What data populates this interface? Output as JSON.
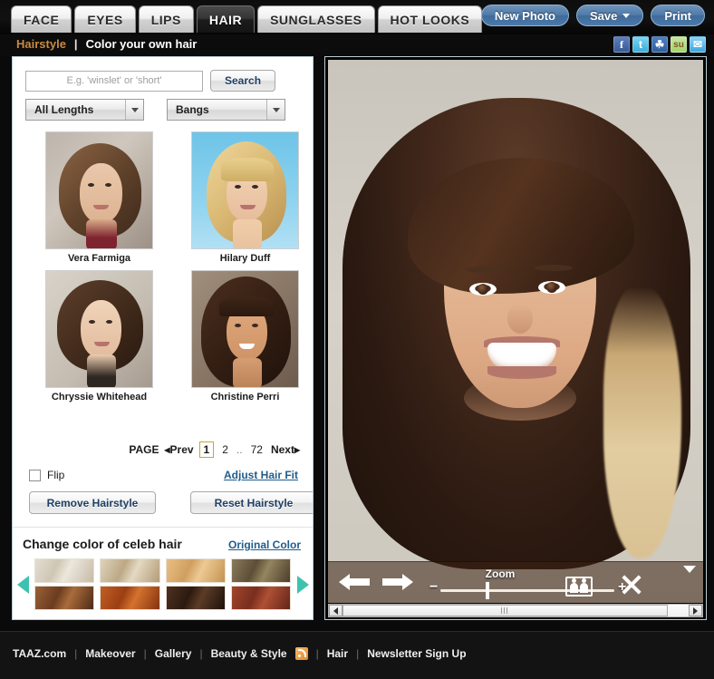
{
  "header": {
    "tabs": [
      {
        "label": "FACE",
        "active": false
      },
      {
        "label": "EYES",
        "active": false
      },
      {
        "label": "LIPS",
        "active": false
      },
      {
        "label": "HAIR",
        "active": true
      },
      {
        "label": "SUNGLASSES",
        "active": false
      },
      {
        "label": "HOT LOOKS",
        "active": false
      }
    ],
    "actions": {
      "new_photo": "New Photo",
      "save": "Save",
      "print": "Print"
    },
    "breadcrumb": {
      "section": "Hairstyle",
      "separator": "|",
      "page": "Color your own hair"
    },
    "social": [
      {
        "name": "facebook-icon",
        "glyph": "f"
      },
      {
        "name": "twitter-icon",
        "glyph": "t"
      },
      {
        "name": "myspace-icon",
        "glyph": "☘"
      },
      {
        "name": "stumbleupon-icon",
        "glyph": "su"
      },
      {
        "name": "email-icon",
        "glyph": "✉"
      }
    ]
  },
  "sidebar": {
    "search": {
      "placeholder": "E.g. 'winslet' or 'short'",
      "value": "",
      "button": "Search"
    },
    "filters": [
      {
        "name": "length-select",
        "value": "All Lengths"
      },
      {
        "name": "bangs-select",
        "value": "Bangs"
      }
    ],
    "celebrities": [
      {
        "name": "Vera Farmiga",
        "bg": "bg1",
        "hair": "#6b4a32",
        "skin": "#e8c2a4"
      },
      {
        "name": "Hilary Duff",
        "bg": "bg2",
        "hair": "#d9b877",
        "skin": "#f0cfb0"
      },
      {
        "name": "Chryssie Whitehead",
        "bg": "bg3",
        "hair": "#4b3225",
        "skin": "#ead0b6"
      },
      {
        "name": "Christine Perri",
        "bg": "bg4",
        "hair": "#3b2418",
        "skin": "#d9a478"
      }
    ],
    "pagination": {
      "label": "PAGE",
      "prev": "◂Prev",
      "current": "1",
      "pages": [
        "2"
      ],
      "ellipsis": "..",
      "last": "72",
      "next": "Next▸"
    },
    "flip": {
      "label": "Flip",
      "checked": false
    },
    "adjust_link": "Adjust Hair Fit",
    "buttons": {
      "remove": "Remove Hairstyle",
      "reset": "Reset Hairstyle"
    },
    "color_section": {
      "title": "Change color of celeb hair",
      "original_link": "Original Color",
      "prev_arrow": "scroll-left",
      "next_arrow": "scroll-right",
      "swatches": [
        {
          "name": "light-ash-blonde",
          "color": "#d8cfc0"
        },
        {
          "name": "beige-blonde",
          "color": "#c9b799"
        },
        {
          "name": "golden-blonde",
          "color": "#d9a86a"
        },
        {
          "name": "dark-ash-brown",
          "color": "#6e5c45"
        },
        {
          "name": "medium-brown",
          "color": "#7b4a2c"
        },
        {
          "name": "copper-red",
          "color": "#b0481f"
        },
        {
          "name": "dark-brown",
          "color": "#3c2415"
        },
        {
          "name": "auburn-red",
          "color": "#8c3a28"
        }
      ]
    }
  },
  "viewer": {
    "toolbar": {
      "back": "back-arrow",
      "forward": "forward-arrow",
      "zoom_label": "Zoom",
      "zoom_minus": "−",
      "zoom_plus": "+",
      "zoom_value": "25",
      "compare": "compare-icon",
      "close": "close-icon",
      "collapse": "collapse-caret"
    }
  },
  "footer": {
    "links": [
      {
        "label": "TAAZ.com",
        "rss": false
      },
      {
        "label": "Makeover",
        "rss": false
      },
      {
        "label": "Gallery",
        "rss": false
      },
      {
        "label": "Beauty & Style",
        "rss": true
      },
      {
        "label": "Hair",
        "rss": false
      },
      {
        "label": "Newsletter Sign Up",
        "rss": false
      }
    ],
    "divider": "|"
  },
  "colors": {
    "accent_orange": "#c58b46",
    "link_blue": "#1f5c8c",
    "button_blue": "#4f7aa8",
    "teal_arrow": "#3ec2b0",
    "page_border": "#c9a33a"
  }
}
